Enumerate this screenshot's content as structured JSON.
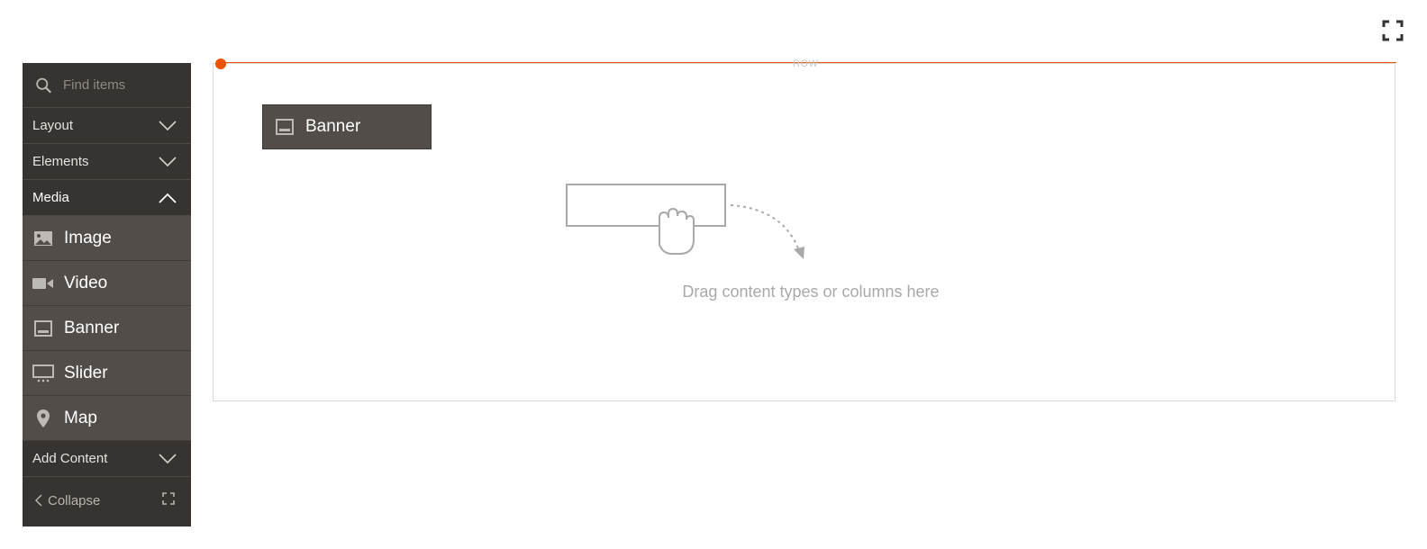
{
  "toolbar": {
    "fullscreen_icon": "fullscreen-icon"
  },
  "panel": {
    "search_placeholder": "Find items",
    "sections": {
      "layout": "Layout",
      "elements": "Elements",
      "media": "Media",
      "add_content": "Add Content"
    },
    "media_items": {
      "image": "Image",
      "video": "Video",
      "banner": "Banner",
      "slider": "Slider",
      "map": "Map"
    },
    "collapse_label": "Collapse"
  },
  "stage": {
    "row_label": "ROW",
    "dragged_item_label": "Banner",
    "drop_hint": "Drag content types or columns here"
  },
  "colors": {
    "panel_bg": "#373330",
    "item_bg": "#524d49",
    "accent": "#eb5202",
    "hint_text": "#a9a9a9"
  }
}
